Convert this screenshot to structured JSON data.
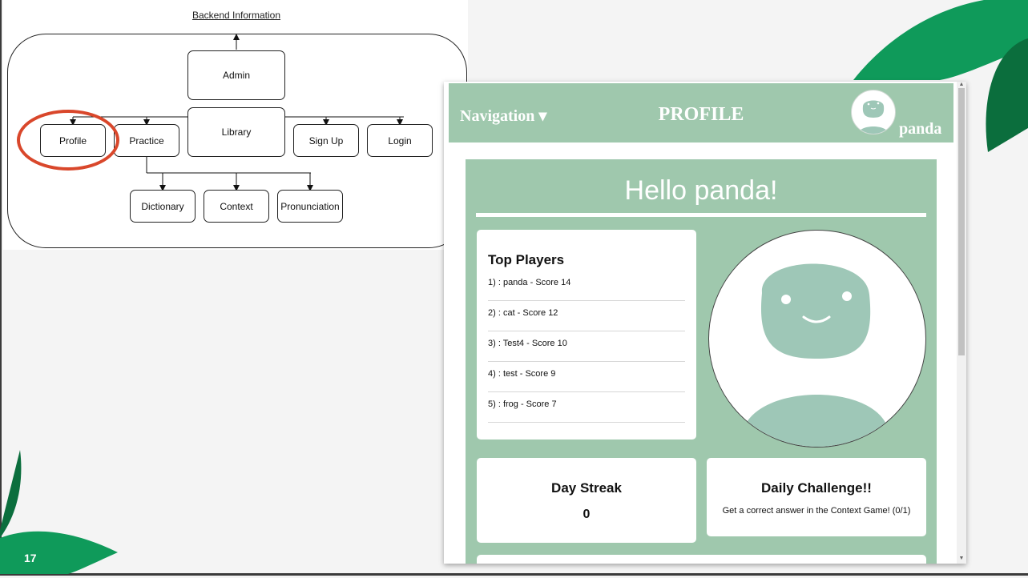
{
  "slide": {
    "number": "17"
  },
  "diagram": {
    "title": "Backend Information",
    "nodes": {
      "admin": "Admin",
      "library": "Library",
      "profile": "Profile",
      "practice": "Practice",
      "signup": "Sign Up",
      "login": "Login",
      "dictionary": "Dictionary",
      "context": "Context",
      "pronunciation": "Pronunciation"
    },
    "highlight_color": "#d9472b"
  },
  "app": {
    "nav": {
      "toggle_label": "Navigation ▾",
      "title": "PROFILE",
      "username": "panda"
    },
    "greeting": "Hello panda!",
    "top_players": {
      "title": "Top Players",
      "items": [
        "1) : panda - Score 14",
        "2) : cat - Score 12",
        "3) : Test4 - Score 10",
        "4) : test - Score 9",
        "5) : frog - Score 7"
      ]
    },
    "day_streak": {
      "title": "Day Streak",
      "value": "0"
    },
    "daily_challenge": {
      "title": "Daily Challenge!!",
      "text": "Get a correct answer in the Context Game! (0/1)"
    },
    "colors": {
      "accent": "#9fc8ad",
      "avatar": "#9ec7b7"
    }
  }
}
